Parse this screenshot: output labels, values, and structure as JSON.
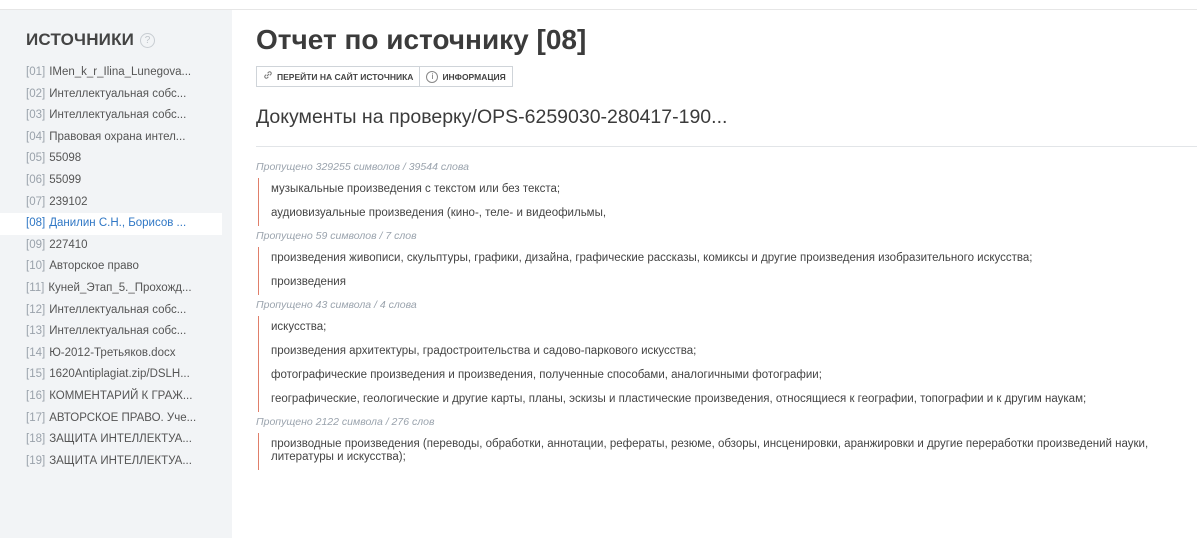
{
  "sidebar": {
    "title": "ИСТОЧНИКИ",
    "help_icon": "?",
    "items": [
      {
        "num": "[01]",
        "label": "IMen_k_r_Ilina_Lunegova..."
      },
      {
        "num": "[02]",
        "label": "Интеллектуальная собс..."
      },
      {
        "num": "[03]",
        "label": "Интеллектуальная собс..."
      },
      {
        "num": "[04]",
        "label": "Правовая охрана интел..."
      },
      {
        "num": "[05]",
        "label": "55098"
      },
      {
        "num": "[06]",
        "label": "55099"
      },
      {
        "num": "[07]",
        "label": "239102"
      },
      {
        "num": "[08]",
        "label": "Данилин С.Н., Борисов ..."
      },
      {
        "num": "[09]",
        "label": "227410"
      },
      {
        "num": "[10]",
        "label": "Авторское право"
      },
      {
        "num": "[11]",
        "label": "Куней_Этап_5._Прохожд..."
      },
      {
        "num": "[12]",
        "label": "Интеллектуальная собс..."
      },
      {
        "num": "[13]",
        "label": "Интеллектуальная собс..."
      },
      {
        "num": "[14]",
        "label": "Ю-2012-Третьяков.docx"
      },
      {
        "num": "[15]",
        "label": "1620Antiplagiat.zip/DSLH..."
      },
      {
        "num": "[16]",
        "label": "КОММЕНТАРИЙ К ГРАЖ..."
      },
      {
        "num": "[17]",
        "label": "АВТОРСКОЕ ПРАВО. Уче..."
      },
      {
        "num": "[18]",
        "label": "ЗАЩИТА ИНТЕЛЛЕКТУА..."
      },
      {
        "num": "[19]",
        "label": "ЗАЩИТА ИНТЕЛЛЕКТУА..."
      }
    ],
    "active_index": 7
  },
  "main": {
    "title": "Отчет по источнику [08]",
    "buttons": {
      "goto_site": "ПЕРЕЙТИ НА САЙТ ИСТОЧНИКА",
      "goto_site_icon": "link-icon",
      "info": "ИНФОРМАЦИЯ",
      "info_icon": "i"
    },
    "document_title": "Документы на проверку/OPS-6259030-280417-190...",
    "sections": [
      {
        "skip": "Пропущено 329255 символов / 39544 слова",
        "lines": [
          "музыкальные произведения с текстом или без текста;",
          "аудиовизуальные произведения (кино-, теле- и видеофильмы,"
        ]
      },
      {
        "skip": "Пропущено 59 символов / 7 слов",
        "lines": [
          "произведения живописи, скульптуры, графики, дизайна, графические рассказы, комиксы и другие произведения изобразительного искусства;",
          "произведения"
        ]
      },
      {
        "skip": "Пропущено 43 символа / 4 слова",
        "lines": [
          "искусства;",
          "произведения архитектуры, градостроительства и садово-паркового искусства;",
          "фотографические произведения и произведения, полученные способами, аналогичными фотографии;",
          "географические, геологические и другие карты, планы, эскизы и пластические произведения, относящиеся к географии, топографии и к другим наукам;"
        ]
      },
      {
        "skip": "Пропущено 2122 символа / 276 слов",
        "lines": [
          "производные произведения (переводы, обработки, аннотации, рефераты, резюме, обзоры, инсценировки, аранжировки и другие переработки произведений науки, литературы и искусства);"
        ]
      }
    ]
  },
  "colors": {
    "accent": "#2f77c5",
    "match_border": "#e07f6a",
    "sidebar_bg": "#f2f4f6"
  }
}
